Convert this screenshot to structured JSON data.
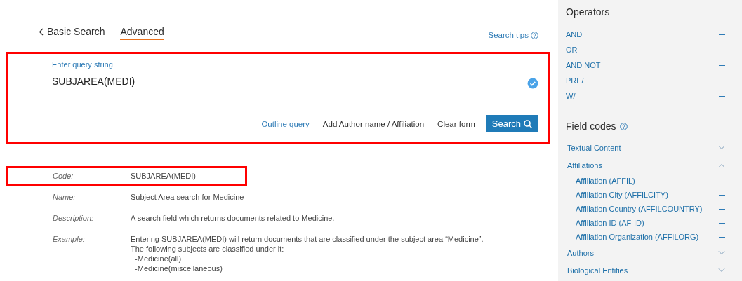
{
  "tabs": [
    {
      "label": "Basic Search",
      "selected": false,
      "kind": "back"
    },
    {
      "label": "Advanced",
      "selected": true,
      "kind": "tab"
    }
  ],
  "search_tips": "Search tips",
  "query": {
    "highlighted": true,
    "label": "Enter query string",
    "value": "SUBJAREA(MEDI)",
    "valid": true,
    "links": [
      "Outline query",
      "Add Author name / Affiliation",
      "Clear form"
    ],
    "button": "Search"
  },
  "details": [
    {
      "label": "Code:",
      "lines": [
        "SUBJAREA(MEDI)"
      ],
      "highlighted": true
    },
    {
      "label": "Name:",
      "lines": [
        "Subject Area search for Medicine"
      ],
      "highlighted": false
    },
    {
      "label": "Description:",
      "lines": [
        "A search field which returns documents related to Medicine."
      ],
      "highlighted": false
    },
    {
      "label": "Example:",
      "lines": [
        "Entering SUBJAREA(MEDI) will return documents that are classified under the subject area “Medicine”.",
        "The following subjects are classified under it:",
        "  -Medicine(all)",
        "  -Medicine(miscellaneous)"
      ],
      "highlighted": false
    }
  ],
  "sidebar": {
    "operators_title": "Operators",
    "operators": [
      "AND",
      "OR",
      "AND NOT",
      "PRE/",
      "W/"
    ],
    "field_codes_title": "Field codes",
    "field_codes": [
      {
        "label": "Textual Content",
        "expanded": false
      },
      {
        "label": "Affiliations",
        "expanded": true,
        "children": [
          "Affiliation (AFFIL)",
          "Affiliation City (AFFILCITY)",
          "Affiliation Country (AFFILCOUNTRY)",
          "Affiliation ID (AF-ID)",
          "Affiliation Organization (AFFILORG)"
        ]
      },
      {
        "label": "Authors",
        "expanded": false
      },
      {
        "label": "Biological Entities",
        "expanded": false
      }
    ]
  }
}
